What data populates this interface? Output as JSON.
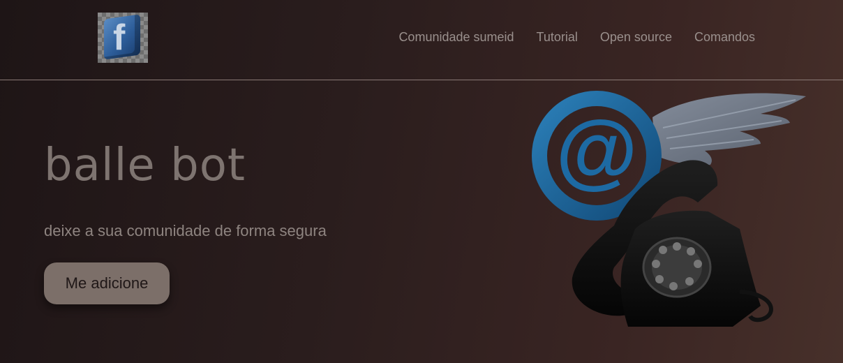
{
  "nav": {
    "items": [
      "Comunidade sumeid",
      "Tutorial",
      "Open source",
      "Comandos"
    ]
  },
  "hero": {
    "title": "balle bot",
    "subtitle": "deixe a sua comunidade de forma segura",
    "cta_label": "Me adicione"
  },
  "logo": {
    "icon": "facebook-cube-icon",
    "letter": "f"
  },
  "illustration": {
    "icon": "winged-email-telephone-icon",
    "at_symbol": "@"
  },
  "colors": {
    "background_start": "#1e1516",
    "background_end": "#47302a",
    "nav_text": "#9a908d",
    "title_text": "#7e7470",
    "button_bg": "#7c6f69"
  }
}
